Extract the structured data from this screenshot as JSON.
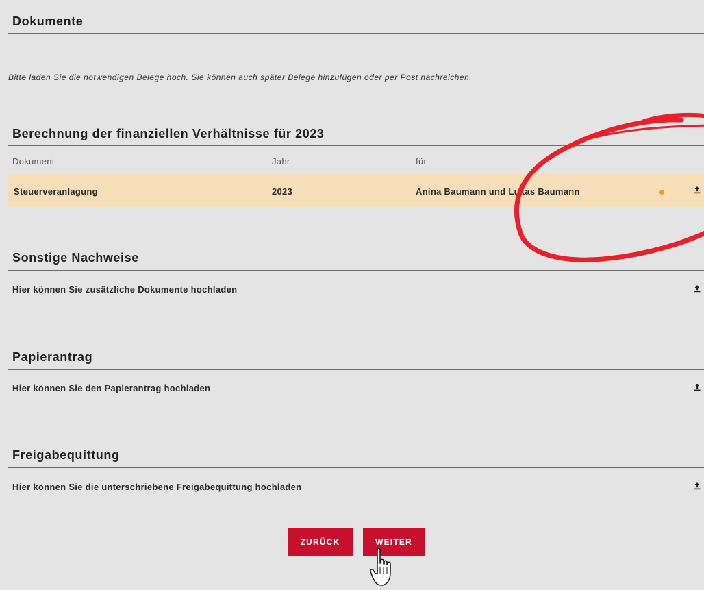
{
  "sections": {
    "documents": {
      "title": "Dokumente",
      "intro": "Bitte laden Sie die notwendigen Belege hoch. Sie können auch später Belege hinzufügen oder per Post nachreichen."
    },
    "financial": {
      "title": "Berechnung der finanziellen Verhältnisse für 2023",
      "columns": [
        "Dokument",
        "Jahr",
        "für"
      ],
      "row": {
        "document": "Steuerveranlagung",
        "year": "2023",
        "for": "Anina Baumann und Lukas Baumann"
      }
    },
    "other": {
      "title": "Sonstige Nachweise",
      "text": "Hier können Sie zusätzliche Dokumente hochladen"
    },
    "paper": {
      "title": "Papierantrag",
      "text": "Hier können Sie den Papierantrag hochladen"
    },
    "release": {
      "title": "Freigabequittung",
      "text": "Hier können Sie die unterschriebene Freigabequittung hochladen"
    }
  },
  "buttons": {
    "back": "ZURÜCK",
    "next": "WEITER"
  },
  "icons": {
    "upload": "upload-icon",
    "status": "status-dot-icon",
    "cursor": "hand-pointer-icon"
  },
  "colors": {
    "accent": "#c8102e",
    "highlight_row": "#f6dfb8",
    "status_dot": "#f0a020",
    "annotation": "#e8202a"
  }
}
